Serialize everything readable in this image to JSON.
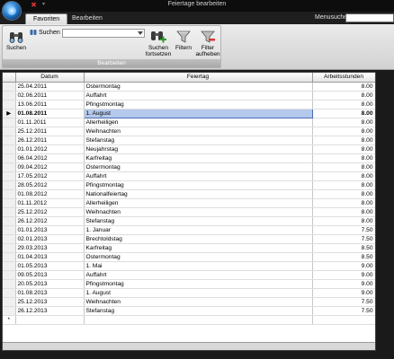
{
  "window": {
    "title": "Feiertage bearbeiten"
  },
  "tabs": [
    {
      "label": "Favoriten",
      "active": true
    },
    {
      "label": "Bearbeiten",
      "active": false
    }
  ],
  "menusuche": {
    "label": "Menusuche",
    "value": ""
  },
  "ribbon": {
    "group_label": "Bearbeiten",
    "search_button": "Suchen",
    "search_field_label": "Suchen",
    "search_value": "",
    "suchen_fortsetzen_line1": "Suchen",
    "suchen_fortsetzen_line2": "fortsetzen",
    "filtern": "Filtern",
    "filter_aufheben_line1": "Filter",
    "filter_aufheben_line2": "aufheben"
  },
  "grid": {
    "columns": [
      "Datum",
      "Feiertag",
      "Arbeitsstunden"
    ],
    "current_row_index": 3,
    "rows": [
      [
        "25.04.2011",
        "Ostermontag",
        "8.00"
      ],
      [
        "02.06.2011",
        "Auffahrt",
        "8.00"
      ],
      [
        "13.06.2011",
        "Pfingstmontag",
        "8.00"
      ],
      [
        "01.08.2011",
        "1. August",
        "8.00"
      ],
      [
        "01.11.2011",
        "Allerheiligen",
        "8.00"
      ],
      [
        "25.12.2011",
        "Weihnachten",
        "8.00"
      ],
      [
        "26.12.2011",
        "Stefanstag",
        "8.00"
      ],
      [
        "01.01.2012",
        "Neujahrstag",
        "8.00"
      ],
      [
        "06.04.2012",
        "Karfreitag",
        "8.00"
      ],
      [
        "09.04.2012",
        "Ostermontag",
        "8.00"
      ],
      [
        "17.05.2012",
        "Auffahrt",
        "8.00"
      ],
      [
        "28.05.2012",
        "Pfingstmontag",
        "8.00"
      ],
      [
        "01.08.2012",
        "Nationalfeiertag",
        "8.00"
      ],
      [
        "01.11.2012",
        "Allerheiligen",
        "8.00"
      ],
      [
        "25.12.2012",
        "Weihnachten",
        "8.00"
      ],
      [
        "26.12.2012",
        "Stefanstag",
        "8.00"
      ],
      [
        "01.01.2013",
        "1. Januar",
        "7.50"
      ],
      [
        "02.01.2013",
        "Brechtoldstag",
        "7.50"
      ],
      [
        "29.03.2013",
        "Karfreitag",
        "8.50"
      ],
      [
        "01.04.2013",
        "Ostermontag",
        "8.50"
      ],
      [
        "01.05.2013",
        "1. Mai",
        "9.00"
      ],
      [
        "09.05.2013",
        "Auffahrt",
        "9.00"
      ],
      [
        "20.05.2013",
        "Pfingstmontag",
        "9.00"
      ],
      [
        "01.08.2013",
        "1. August",
        "9.00"
      ],
      [
        "25.12.2013",
        "Weihnachten",
        "7.50"
      ],
      [
        "26.12.2013",
        "Stefanstag",
        "7.50"
      ]
    ],
    "new_row_marker": "*",
    "current_row_marker": "▶"
  }
}
